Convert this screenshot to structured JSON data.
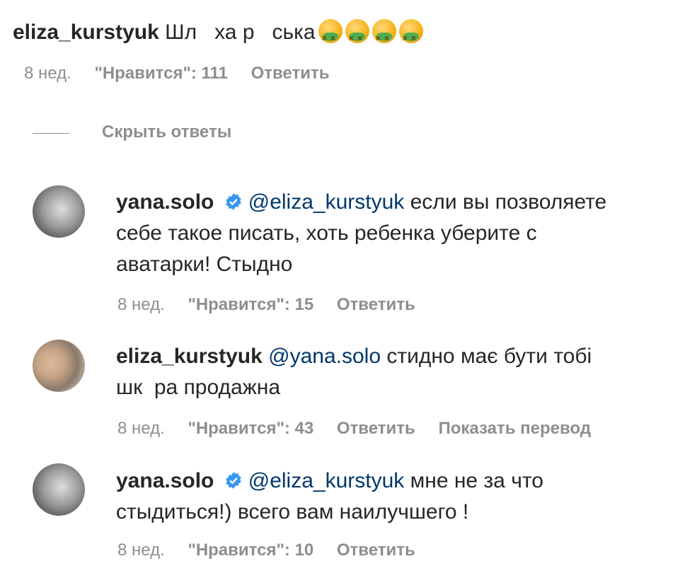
{
  "top_comment": {
    "username": "eliza_kurstyuk",
    "text": "Шл   ха р   ська",
    "emoji_icons": [
      "nauseated-face-icon",
      "nauseated-face-icon",
      "nauseated-face-icon",
      "nauseated-face-icon"
    ],
    "time": "8 нед.",
    "likes": "\"Нравится\": 111",
    "reply_label": "Ответить"
  },
  "hide_replies_label": "Скрыть ответы",
  "replies": [
    {
      "username": "yana.solo",
      "verified": true,
      "mention": "@eliza_kurstyuk",
      "line1": "если вы позволяете",
      "line2": "себе такое писать, хоть ребенка уберите с",
      "line3": "аватарки! Стыдно",
      "time": "8 нед.",
      "likes": "\"Нравится\": 15",
      "reply_label": "Ответить"
    },
    {
      "username": "eliza_kurstyuk",
      "verified": false,
      "mention": "@yana.solo",
      "line1": "стидно має бути тобі",
      "line2": "шк  ра продажна",
      "time": "8 нед.",
      "likes": "\"Нравится\": 43",
      "reply_label": "Ответить",
      "translate_label": "Показать перевод"
    },
    {
      "username": "yana.solo",
      "verified": true,
      "mention": "@eliza_kurstyuk",
      "line1": "мне не за что",
      "line2": "стыдиться!) всего вам наилучшего !",
      "time": "8 нед.",
      "likes": "\"Нравится\": 10",
      "reply_label": "Ответить"
    }
  ],
  "colors": {
    "text": "#262626",
    "meta": "#8e8e8e",
    "mention": "#00376b",
    "verified": "#3897f0"
  }
}
